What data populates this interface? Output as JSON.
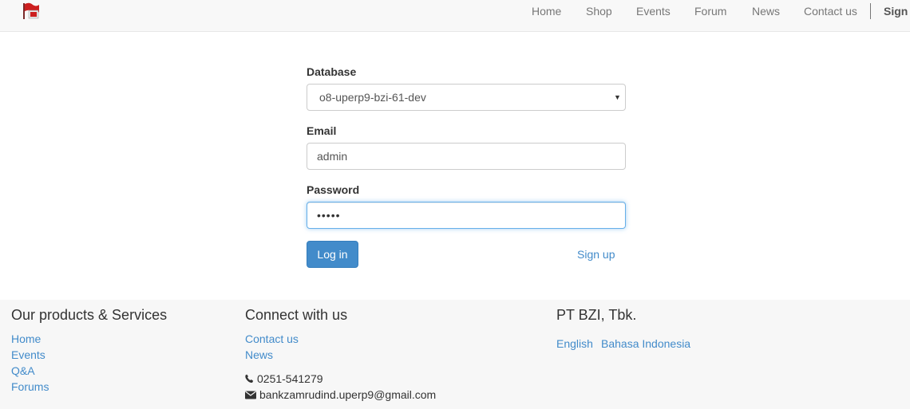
{
  "navbar": {
    "logo_icon": "flag-logo-icon",
    "items": [
      {
        "label": "Home"
      },
      {
        "label": "Shop"
      },
      {
        "label": "Events"
      },
      {
        "label": "Forum"
      },
      {
        "label": "News"
      },
      {
        "label": "Contact us"
      }
    ],
    "signin_label": "Sign"
  },
  "login_form": {
    "database_label": "Database",
    "database_value": "o8-uperp9-bzi-61-dev",
    "email_label": "Email",
    "email_value": "admin",
    "password_label": "Password",
    "password_value": "•••••",
    "login_button": "Log in",
    "signup_link": "Sign up"
  },
  "footer": {
    "products": {
      "title": "Our products & Services",
      "links": [
        "Home",
        "Events",
        "Q&A",
        "Forums"
      ]
    },
    "connect": {
      "title": "Connect with us",
      "links": [
        "Contact us",
        "News"
      ],
      "phone": "0251-541279",
      "phone_icon": "phone-icon",
      "email": "bankzamrudind.uperp9@gmail.com",
      "email_icon": "envelope-icon"
    },
    "company": {
      "title": "PT BZI, Tbk.",
      "languages": [
        "English",
        "Bahasa Indonesia"
      ]
    }
  },
  "colors": {
    "primary": "#428bca",
    "navbar_bg": "#f8f8f8",
    "footer_bg": "#f7f7f7",
    "logo_red": "#cc1f1f"
  }
}
